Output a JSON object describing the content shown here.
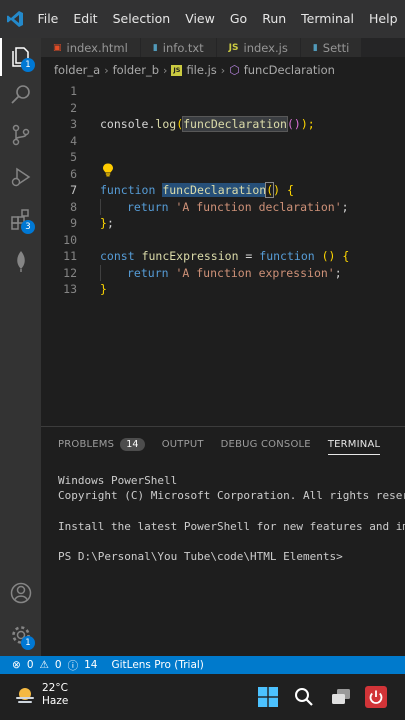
{
  "menu": [
    "File",
    "Edit",
    "Selection",
    "View",
    "Go",
    "Run",
    "Terminal",
    "Help"
  ],
  "activity_badges": {
    "explorer": "1",
    "extensions": "3",
    "settings": "1"
  },
  "tabs": [
    {
      "label": "index.html",
      "icon": "html-icon",
      "icon_color": "#e44d26"
    },
    {
      "label": "info.txt",
      "icon": "text-file-icon",
      "icon_color": "#519aba"
    },
    {
      "label": "index.js",
      "icon": "js-icon",
      "icon_color": "#cbcb41"
    },
    {
      "label": "Setti",
      "icon": "settings-file-icon",
      "icon_color": "#519aba"
    }
  ],
  "breadcrumb": [
    "folder_a",
    "folder_b",
    "file.js",
    "funcDeclaration"
  ],
  "line_numbers": [
    "1",
    "2",
    "3",
    "4",
    "5",
    "6",
    "7",
    "8",
    "9",
    "10",
    "11",
    "12",
    "13"
  ],
  "code": {
    "l3": [
      "console",
      ".",
      "log",
      "(",
      "funcDeclaration",
      "()",
      ");"
    ],
    "l7": [
      "function",
      " ",
      "funcDeclaration",
      "(",
      ")",
      " {"
    ],
    "l8": [
      "return",
      " ",
      "'A function declaration'",
      ";"
    ],
    "l9": [
      "}",
      ";"
    ],
    "l11": [
      "const",
      " ",
      "funcExpression",
      " = ",
      "function",
      " ",
      "()",
      " {"
    ],
    "l12": [
      "return",
      " ",
      "'A function expression'",
      ";"
    ],
    "l13": [
      "}"
    ]
  },
  "panel": {
    "tabs": [
      "PROBLEMS",
      "OUTPUT",
      "DEBUG CONSOLE",
      "TERMINAL"
    ],
    "problems_count": "14",
    "active_tab": "TERMINAL"
  },
  "terminal": [
    "Windows PowerShell",
    "Copyright (C) Microsoft Corporation. All rights reser",
    "",
    "Install the latest PowerShell for new features and im",
    "",
    "PS D:\\Personal\\You Tube\\code\\HTML Elements>"
  ],
  "status": {
    "errors": "0",
    "warnings": "0",
    "info": "14",
    "gitlens": "GitLens Pro (Trial)"
  },
  "taskbar": {
    "temp": "22°C",
    "weather": "Haze"
  },
  "colors": {
    "accent": "#007acc",
    "keyword": "#569cd6",
    "function": "#dcdcaa",
    "string": "#ce9178"
  }
}
